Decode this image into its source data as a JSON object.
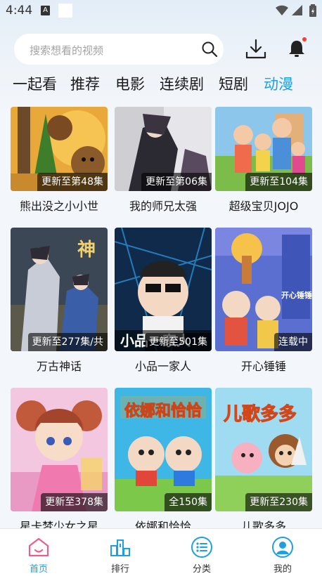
{
  "status_bar": {
    "time": "4:44",
    "notice_letter": "A"
  },
  "search": {
    "placeholder": "搜索想看的视频"
  },
  "tabs": [
    {
      "label": "一起看",
      "active": false
    },
    {
      "label": "推荐",
      "active": false
    },
    {
      "label": "电影",
      "active": false
    },
    {
      "label": "连续剧",
      "active": false
    },
    {
      "label": "短剧",
      "active": false
    },
    {
      "label": "动漫",
      "active": true
    }
  ],
  "cards": [
    {
      "title": "熊出没之小小世",
      "badge": "更新至第48集"
    },
    {
      "title": "我的师兄太强",
      "badge": "更新至第06集"
    },
    {
      "title": "超级宝贝JOJO",
      "badge": "更新至104集"
    },
    {
      "title": "万古神话",
      "badge": "更新至277集/共"
    },
    {
      "title": "小品一家人",
      "badge": "更新至501集"
    },
    {
      "title": "开心锤锤",
      "badge": "连载中"
    },
    {
      "title": "星卡梦少女之星",
      "badge": "更新至378集"
    },
    {
      "title": "依娜和恰恰",
      "badge": "全150集"
    },
    {
      "title": "儿歌多多",
      "badge": "更新至230集"
    }
  ],
  "poster_art": {
    "card_6_text": "开心锤锤",
    "card_7_text": "小品一家人",
    "card_8_text": "依娜和恰恰",
    "card_9_text": "儿歌多多",
    "card_4_text": "神"
  },
  "nav": [
    {
      "label": "首页",
      "icon": "home-icon",
      "active": true
    },
    {
      "label": "排行",
      "icon": "ranking-icon",
      "active": false
    },
    {
      "label": "分类",
      "icon": "category-icon",
      "active": false
    },
    {
      "label": "我的",
      "icon": "profile-icon",
      "active": false
    }
  ],
  "colors": {
    "accent": "#1e9fe0",
    "notification_dot": "#ff3b30"
  }
}
